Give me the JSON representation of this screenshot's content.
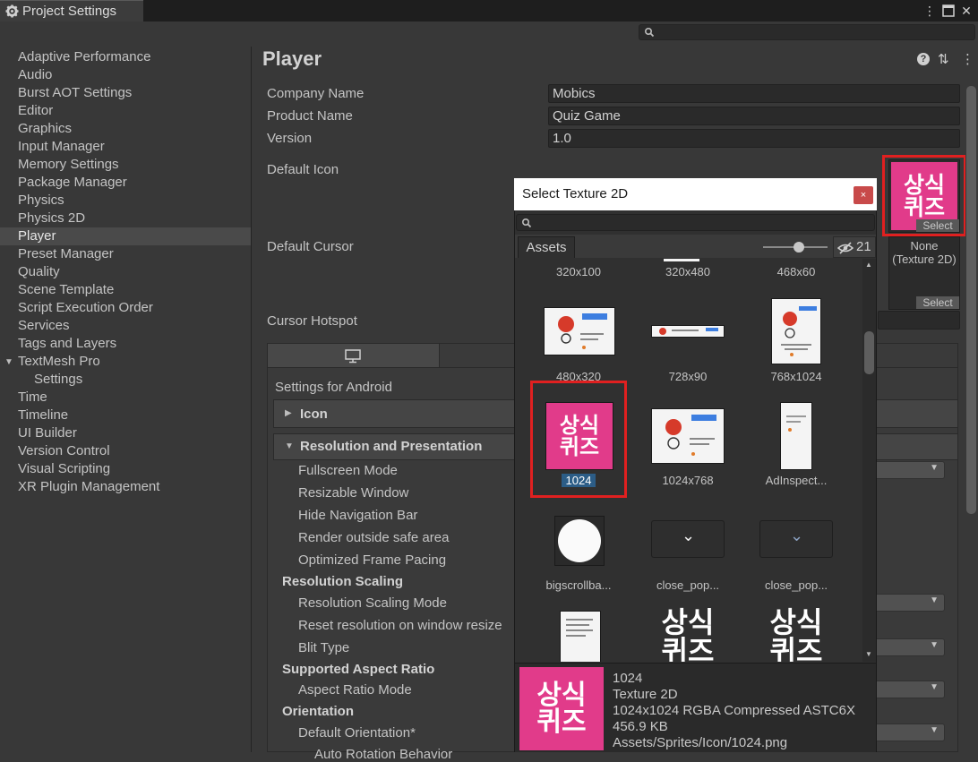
{
  "window": {
    "tab_title": "Project Settings",
    "menu_icon": "kebab-icon",
    "maximize_icon": "maximize-icon",
    "close_icon": "close-icon"
  },
  "sidebar": {
    "items": [
      {
        "label": "Adaptive Performance"
      },
      {
        "label": "Audio"
      },
      {
        "label": "Burst AOT Settings"
      },
      {
        "label": "Editor"
      },
      {
        "label": "Graphics"
      },
      {
        "label": "Input Manager"
      },
      {
        "label": "Memory Settings"
      },
      {
        "label": "Package Manager"
      },
      {
        "label": "Physics"
      },
      {
        "label": "Physics 2D"
      },
      {
        "label": "Player"
      },
      {
        "label": "Preset Manager"
      },
      {
        "label": "Quality"
      },
      {
        "label": "Scene Template"
      },
      {
        "label": "Script Execution Order"
      },
      {
        "label": "Services"
      },
      {
        "label": "Tags and Layers"
      },
      {
        "label": "TextMesh Pro"
      },
      {
        "label": "Settings"
      },
      {
        "label": "Time"
      },
      {
        "label": "Timeline"
      },
      {
        "label": "UI Builder"
      },
      {
        "label": "Version Control"
      },
      {
        "label": "Visual Scripting"
      },
      {
        "label": "XR Plugin Management"
      }
    ],
    "selected": "Player"
  },
  "player": {
    "title": "Player",
    "company_label": "Company Name",
    "company_value": "Mobics",
    "product_label": "Product Name",
    "product_value": "Quiz Game",
    "version_label": "Version",
    "version_value": "1.0",
    "default_icon_label": "Default Icon",
    "default_cursor_label": "Default Cursor",
    "cursor_hotspot_label": "Cursor Hotspot",
    "icon_select": "Select",
    "cursor_none": "None",
    "cursor_type": "(Texture 2D)",
    "cursor_select": "Select",
    "icon_text_line1": "상식",
    "icon_text_line2": "퀴즈"
  },
  "settings": {
    "for_android": "Settings for Android",
    "icon_section": "Icon",
    "res_section": "Resolution and Presentation",
    "items": {
      "fullscreen": "Fullscreen Mode",
      "resizable": "Resizable Window",
      "hide_nav": "Hide Navigation Bar",
      "render_safe": "Render outside safe area",
      "frame_pacing": "Optimized Frame Pacing",
      "res_scaling": "Resolution Scaling",
      "res_scaling_mode": "Resolution Scaling Mode",
      "reset_res": "Reset resolution on window resize",
      "blit": "Blit Type",
      "aspect": "Supported Aspect Ratio",
      "aspect_mode": "Aspect Ratio Mode",
      "orientation": "Orientation",
      "default_orientation": "Default Orientation*",
      "auto_rotation": "Auto Rotation Behavior"
    }
  },
  "popup": {
    "title": "Select Texture 2D",
    "close": "×",
    "assets_tab": "Assets",
    "count": "21",
    "items": [
      {
        "caption": "320x100"
      },
      {
        "caption": "320x480"
      },
      {
        "caption": "468x60"
      },
      {
        "caption": "480x320"
      },
      {
        "caption": "728x90"
      },
      {
        "caption": "768x1024"
      },
      {
        "caption": "1024"
      },
      {
        "caption": "1024x768"
      },
      {
        "caption": "AdInspect..."
      },
      {
        "caption": "bigscrollba..."
      },
      {
        "caption": "close_pop..."
      },
      {
        "caption": "close_pop..."
      }
    ],
    "preview": {
      "name": "1024",
      "type": "Texture 2D",
      "info": "1024x1024  RGBA Compressed ASTC6X",
      "size": "456.9 KB",
      "path": "Assets/Sprites/Icon/1024.png"
    }
  },
  "colors": {
    "accent_pink": "#e13b8a",
    "selection_blue": "#2c5d87",
    "highlight_red": "#e02020"
  }
}
